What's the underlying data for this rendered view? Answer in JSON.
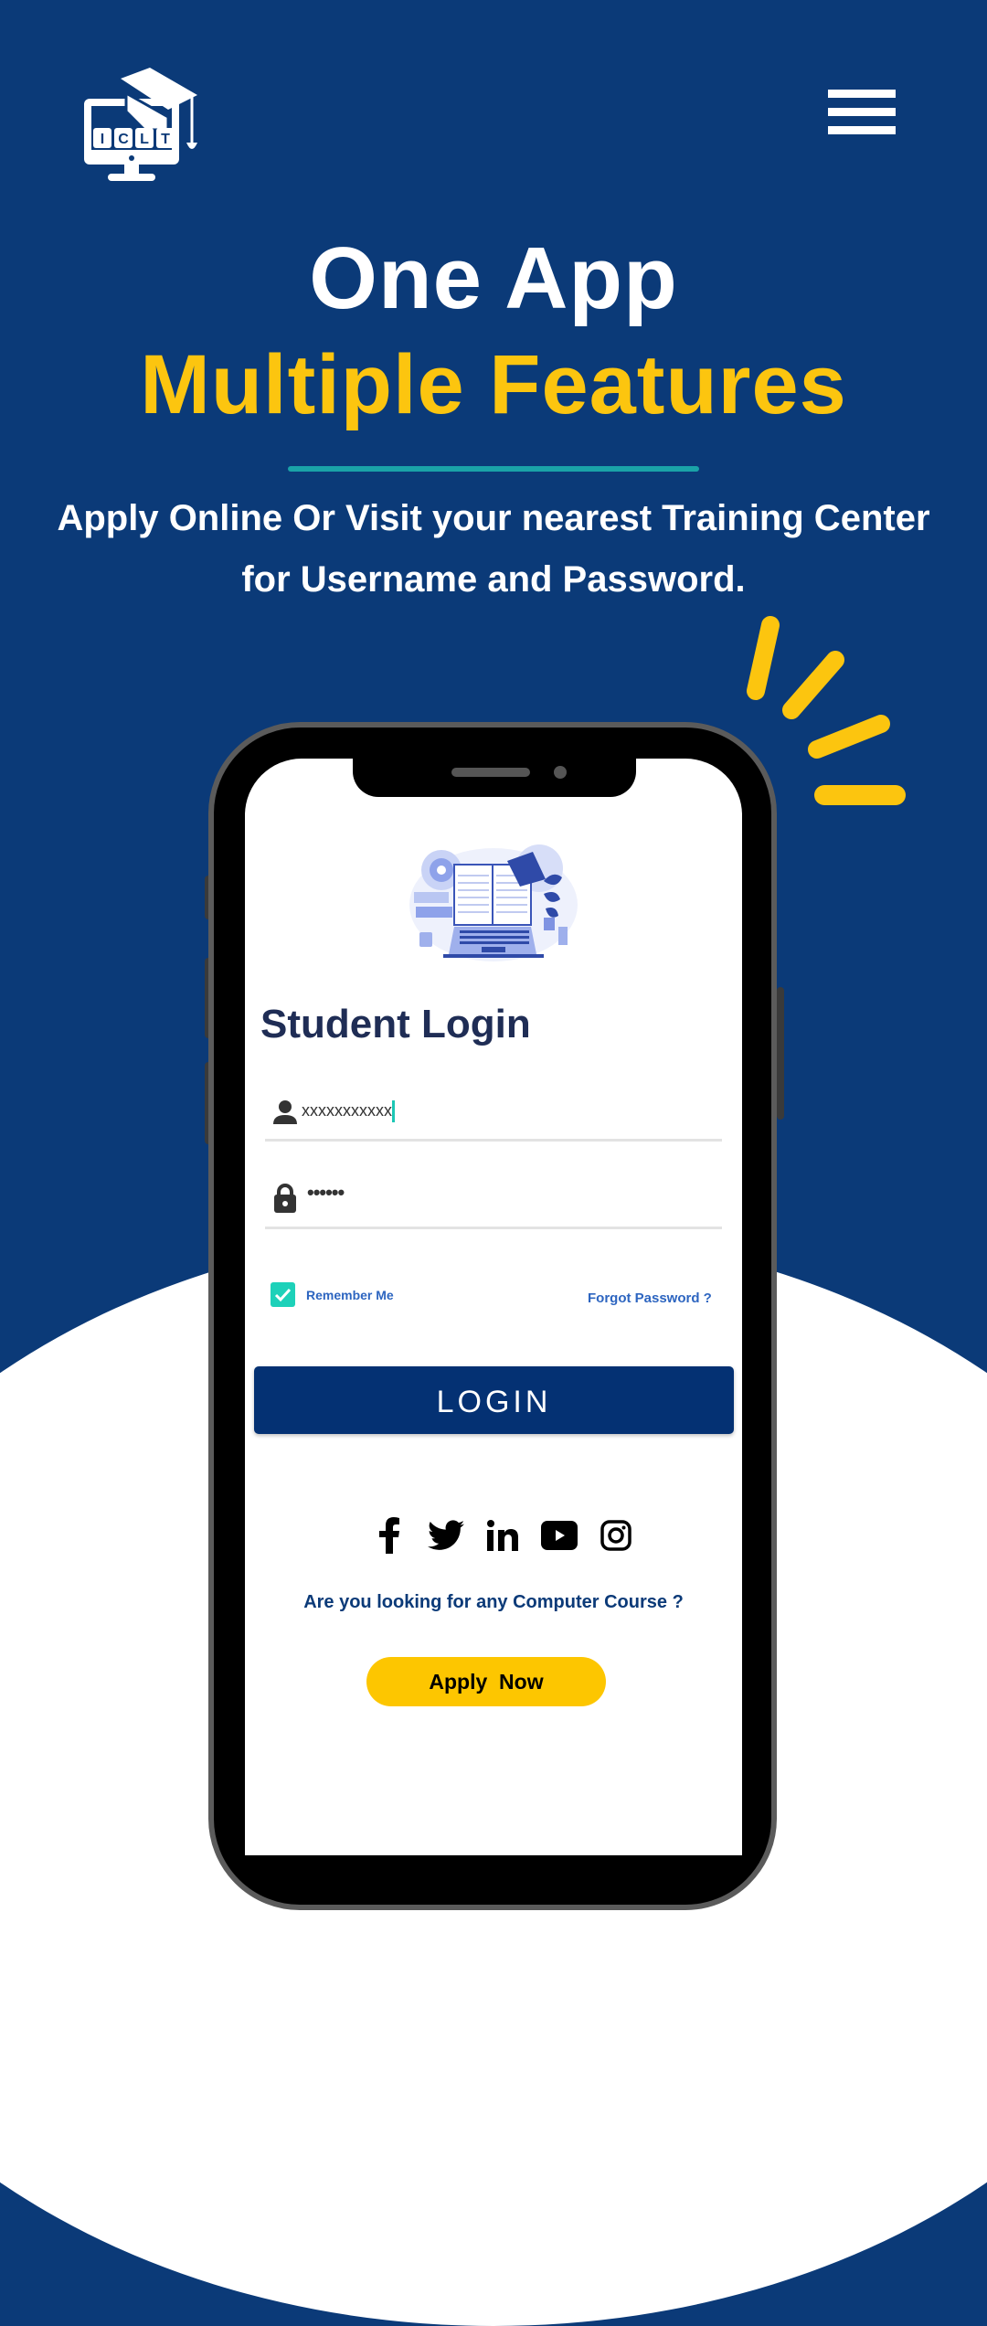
{
  "header": {
    "logo_text": "ICLT",
    "logo_icon": "graduation-cap-monitor-logo",
    "menu_icon": "hamburger-menu-icon"
  },
  "hero": {
    "title": "One App",
    "subtitle": "Multiple Features",
    "tagline": "Apply Online Or Visit your nearest Training Center for  Username and Password."
  },
  "login": {
    "title": "Student Login",
    "username": {
      "icon": "person-icon",
      "value": "xxxxxxxxxxx"
    },
    "password": {
      "icon": "lock-icon",
      "value": "••••••"
    },
    "remember_me": {
      "label": "Remember Me",
      "checked": true
    },
    "forgot_password": "Forgot Password ?",
    "login_button": "LOGIN"
  },
  "social": [
    {
      "name": "facebook",
      "icon": "facebook-icon"
    },
    {
      "name": "twitter",
      "icon": "twitter-icon"
    },
    {
      "name": "linkedin",
      "icon": "linkedin-icon"
    },
    {
      "name": "youtube",
      "icon": "youtube-icon"
    },
    {
      "name": "instagram",
      "icon": "instagram-icon"
    }
  ],
  "footer": {
    "question": "Are you looking for any Computer Course ?",
    "apply_button": "Apply  Now"
  },
  "colors": {
    "background": "#0b3a78",
    "accent_yellow": "#fcc50f",
    "divider_teal": "#1aa3a8",
    "login_button": "#043173",
    "checkbox": "#1dd1b9",
    "link_blue": "#2d65c0",
    "apply_button": "#fdc600"
  }
}
